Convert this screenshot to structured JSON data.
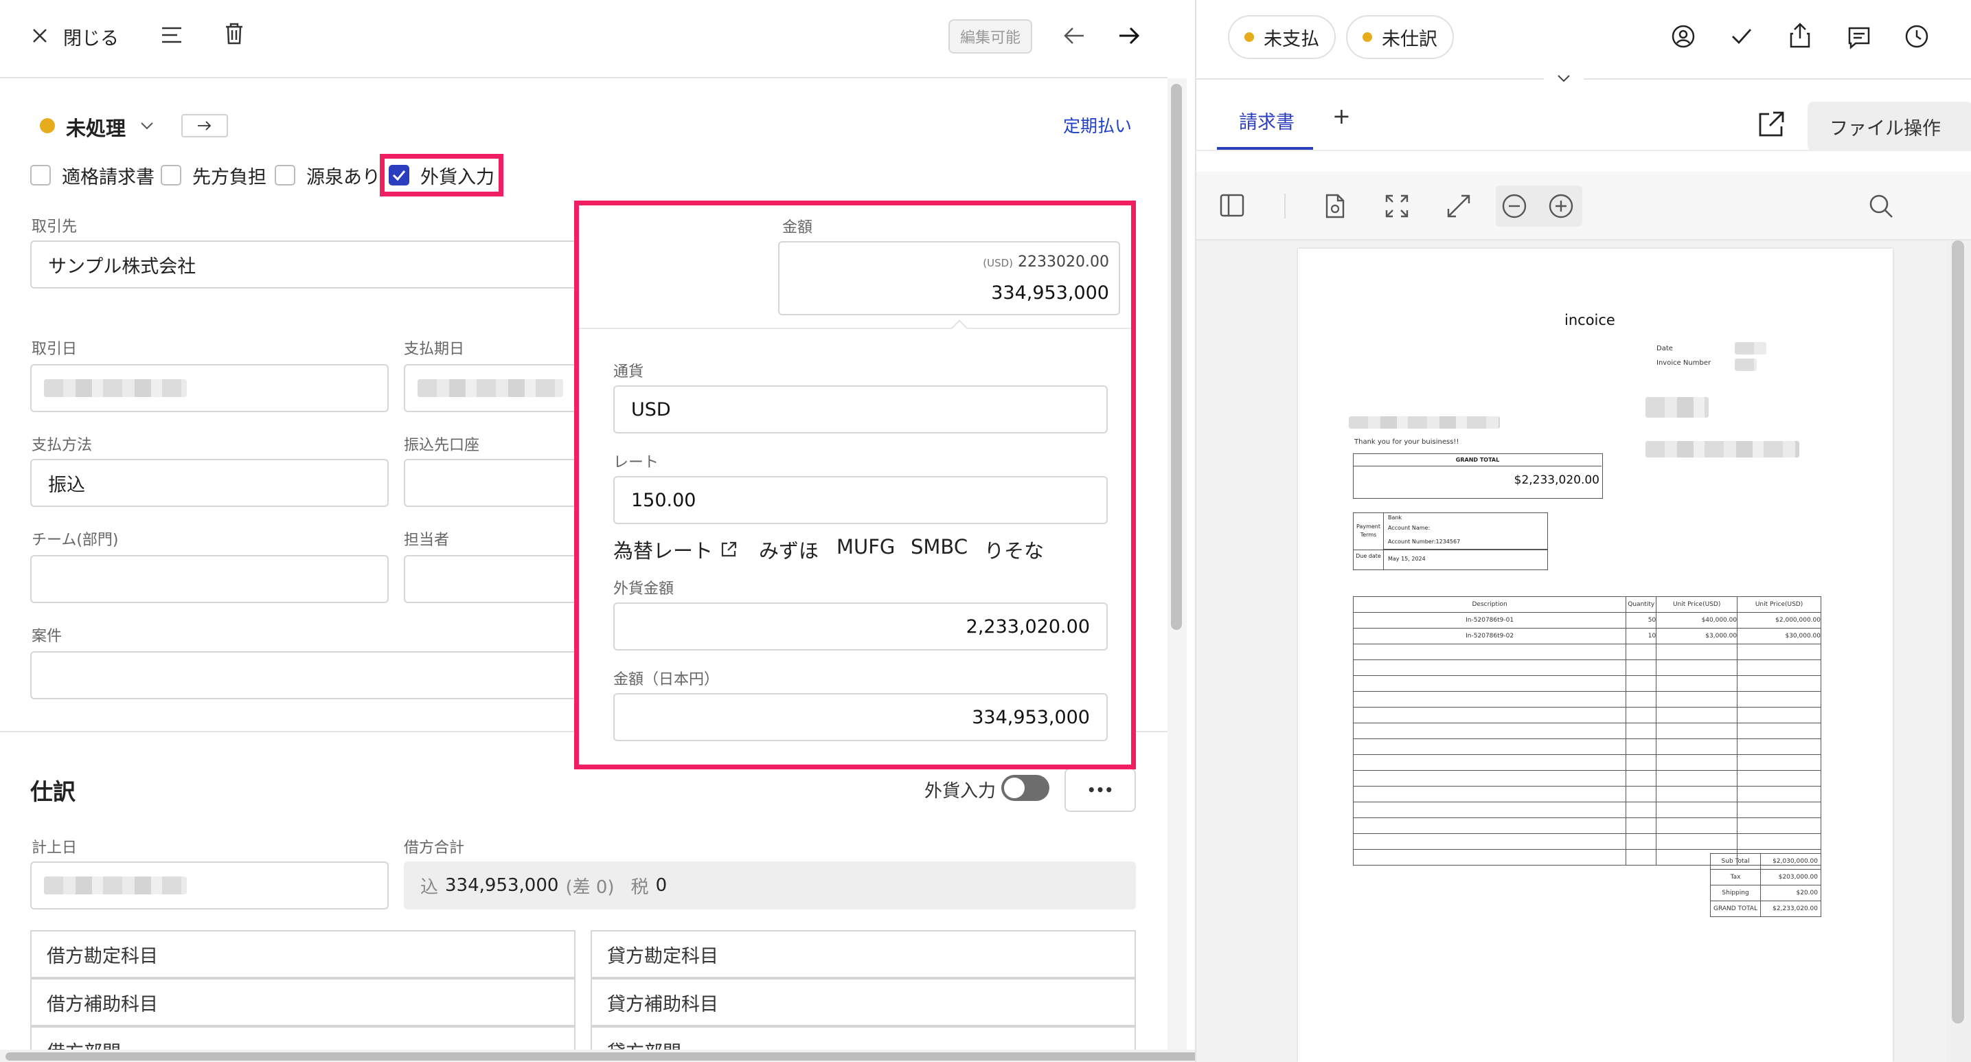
{
  "header": {
    "close_label": "閉じる",
    "editable_badge": "編集可能"
  },
  "status": {
    "label": "未処理",
    "recurring_link": "定期払い"
  },
  "options": [
    {
      "label": "適格請求書",
      "checked": false
    },
    {
      "label": "先方負担",
      "checked": false
    },
    {
      "label": "源泉あり",
      "checked": false
    },
    {
      "label": "外貨入力",
      "checked": true
    }
  ],
  "form": {
    "partner_label": "取引先",
    "partner_value": "サンプル株式会社",
    "amount_label": "金額",
    "amount_fx": "2233020.00",
    "amount_fx_currency": "(USD)",
    "amount_jpy": "334,953,000",
    "trade_date_label": "取引日",
    "due_date_label": "支払期日",
    "payment_method_label": "支払方法",
    "payment_method_value": "振込",
    "bank_account_label": "振込先口座",
    "team_label": "チーム(部門)",
    "assignee_label": "担当者",
    "project_label": "案件"
  },
  "popover": {
    "currency_label": "通貨",
    "currency_value": "USD",
    "rate_label": "レート",
    "rate_value": "150.00",
    "rate_link": "為替レート",
    "banks": [
      "みずほ",
      "MUFG",
      "SMBC",
      "りそな"
    ],
    "fx_amount_label": "外貨金額",
    "fx_amount_value": "2,233,020.00",
    "jpy_amount_label": "金額（日本円）",
    "jpy_amount_value": "334,953,000"
  },
  "journal": {
    "title": "仕訳",
    "fx_toggle_label": "外貨入力",
    "more_label": "•••",
    "posting_date_label": "計上日",
    "debit_total_label": "借方合計",
    "debit_total_prefix": "込",
    "debit_total_value": "334,953,000",
    "debit_total_diff": "(差 0)",
    "tax_label": "税",
    "tax_value": "0",
    "debit_account": "借方勘定科目",
    "debit_sub_account": "借方補助科目",
    "debit_dept": "借方部門",
    "credit_account": "貸方勘定科目",
    "credit_sub_account": "貸方補助科目",
    "credit_dept": "貸方部門"
  },
  "right": {
    "pill_unpaid": "未支払",
    "pill_unjournaled": "未仕訳",
    "tab_invoice": "請求書",
    "tab_add": "+",
    "file_ops": "ファイル操作"
  },
  "invoice": {
    "title": "incoice",
    "date_label": "Date",
    "invoice_number_label": "Invoice Number",
    "thanks": "Thank you for your buisiness!!",
    "grand_total_label": "GRAND TOTAL",
    "grand_total_value": "$2,233,020.00",
    "payment_terms_label": "Payment Terms",
    "bank": "Bank",
    "account_name": "Account Name:",
    "account_number": "Account Number:1234567",
    "due_date_label": "Due date",
    "due_date_value": "May 15, 2024",
    "columns": [
      "Description",
      "Quantity",
      "Unit Price(USD)",
      "Unit Price(USD)"
    ],
    "rows": [
      [
        "In-520786t9-01",
        "50",
        "$40,000.00",
        "$2,000,000.00"
      ],
      [
        "In-520786t9-02",
        "10",
        "$3,000.00",
        "$30,000.00"
      ]
    ],
    "totals": [
      [
        "Sub Total",
        "$2,030,000.00"
      ],
      [
        "Tax",
        "$203,000.00"
      ],
      [
        "Shipping",
        "$20.00"
      ],
      [
        "GRAND TOTAL",
        "$2,233,020.00"
      ]
    ]
  },
  "colors": {
    "accent": "#2b3ec0",
    "highlight": "#ef1f61",
    "status_dot": "#e6ac1b",
    "link": "#2140c8"
  }
}
